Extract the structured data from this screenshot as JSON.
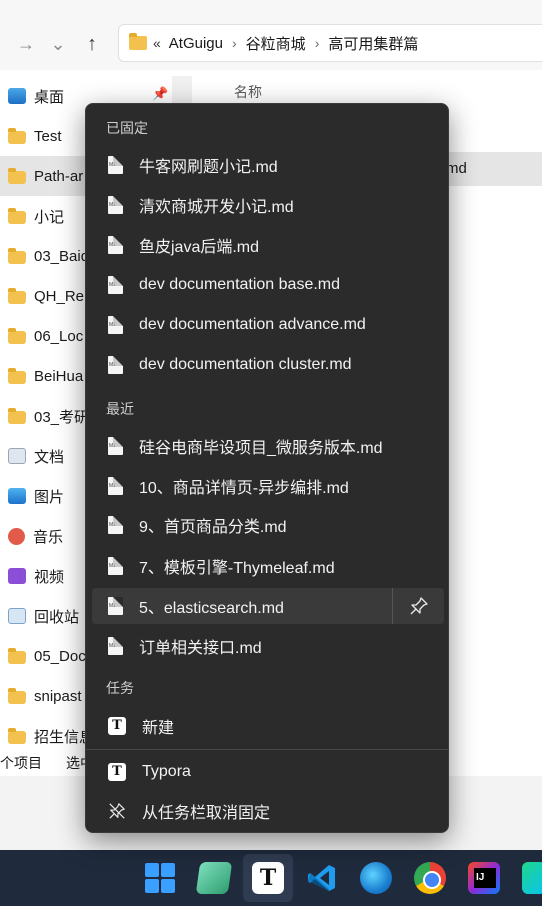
{
  "explorer": {
    "nav": {
      "back": "←",
      "forward": "→",
      "recent": "⌄",
      "up": "↑"
    },
    "address": {
      "prefix": "«",
      "crumbs": [
        "AtGuigu",
        "谷粒商城",
        "高可用集群篇"
      ],
      "sep": "›"
    },
    "sidebar": {
      "items": [
        {
          "label": "桌面",
          "icon": "desktop"
        },
        {
          "label": "Test",
          "icon": "folder"
        },
        {
          "label": "Path-ar",
          "icon": "folder"
        },
        {
          "label": "小记",
          "icon": "folder"
        },
        {
          "label": "03_Baid",
          "icon": "folder"
        },
        {
          "label": "QH_Re",
          "icon": "folder"
        },
        {
          "label": "06_Loc",
          "icon": "folder"
        },
        {
          "label": "BeiHua",
          "icon": "folder"
        },
        {
          "label": "03_考研",
          "icon": "folder"
        },
        {
          "label": "文档",
          "icon": "docs"
        },
        {
          "label": "图片",
          "icon": "pics"
        },
        {
          "label": "音乐",
          "icon": "music"
        },
        {
          "label": "视频",
          "icon": "video"
        },
        {
          "label": "回收站",
          "icon": "recycle"
        },
        {
          "label": "05_Doc",
          "icon": "folder"
        },
        {
          "label": "snipast",
          "icon": "folder"
        },
        {
          "label": "招生信息",
          "icon": "folder"
        }
      ]
    },
    "column_header": "名称",
    "selected_file_suffix": "md",
    "status": {
      "count": "个项目",
      "selected": "选中"
    }
  },
  "jumplist": {
    "pinned_header": "已固定",
    "pinned": [
      "牛客网刷题小记.md",
      "清欢商城开发小记.md",
      "鱼皮java后端.md",
      "dev documentation base.md",
      "dev documentation advance.md",
      "dev documentation cluster.md"
    ],
    "recent_header": "最近",
    "recent": [
      "硅谷电商毕设项目_微服务版本.md",
      "10、商品详情页-异步编排.md",
      "9、首页商品分类.md",
      "7、模板引擎-Thymeleaf.md",
      "5、elasticsearch.md",
      "订单相关接口.md"
    ],
    "tasks_header": "任务",
    "tasks": [
      "新建"
    ],
    "app_name": "Typora",
    "unpin_label": "从任务栏取消固定",
    "pin_glyph": "⚲"
  },
  "taskbar": {
    "icons": [
      "windows-start-icon",
      "sticky-notes-icon",
      "typora-icon",
      "vscode-icon",
      "edge-icon",
      "chrome-icon",
      "intellij-idea-icon",
      "datagrip-icon"
    ],
    "typora_letter": "T"
  },
  "colors": {
    "menu_bg": "#2b2b2b",
    "menu_hover": "#3a3a3a",
    "taskbar_bg": "#1f2a3c",
    "folder": "#f2c14e"
  }
}
